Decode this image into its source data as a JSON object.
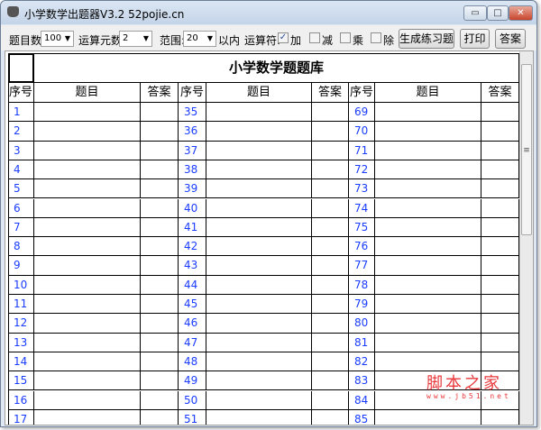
{
  "window": {
    "title": "小学数学出题器V3.2 52pojie.cn",
    "minimize": "▭",
    "maximize": "□",
    "close": "✕"
  },
  "toolbar": {
    "count_label": "题目数:",
    "count_value": "100",
    "operands_label": "运算元数:",
    "operands_value": "2",
    "range_label": "范围:",
    "range_value": "20",
    "range_suffix": "以内",
    "operators_label": "运算符:",
    "operators": [
      {
        "label": "加",
        "checked": true
      },
      {
        "label": "减",
        "checked": false
      },
      {
        "label": "乘",
        "checked": false
      },
      {
        "label": "除",
        "checked": false
      }
    ],
    "generate_button": "生成练习题",
    "print_button": "打印",
    "answer_button": "答案"
  },
  "sheet": {
    "title": "小学数学题题库",
    "headers": [
      "序号",
      "题目",
      "答案"
    ],
    "columns": [
      [
        1,
        2,
        3,
        4,
        5,
        6,
        7,
        8,
        9,
        10,
        11,
        12,
        13,
        14,
        15,
        16,
        17
      ],
      [
        35,
        36,
        37,
        38,
        39,
        40,
        41,
        42,
        43,
        44,
        45,
        46,
        47,
        48,
        49,
        50,
        51
      ],
      [
        69,
        70,
        71,
        72,
        73,
        74,
        75,
        76,
        77,
        78,
        79,
        80,
        81,
        82,
        83,
        84,
        85
      ]
    ]
  },
  "watermark": {
    "text": "脚本之家",
    "url": "www.jb51.net"
  }
}
